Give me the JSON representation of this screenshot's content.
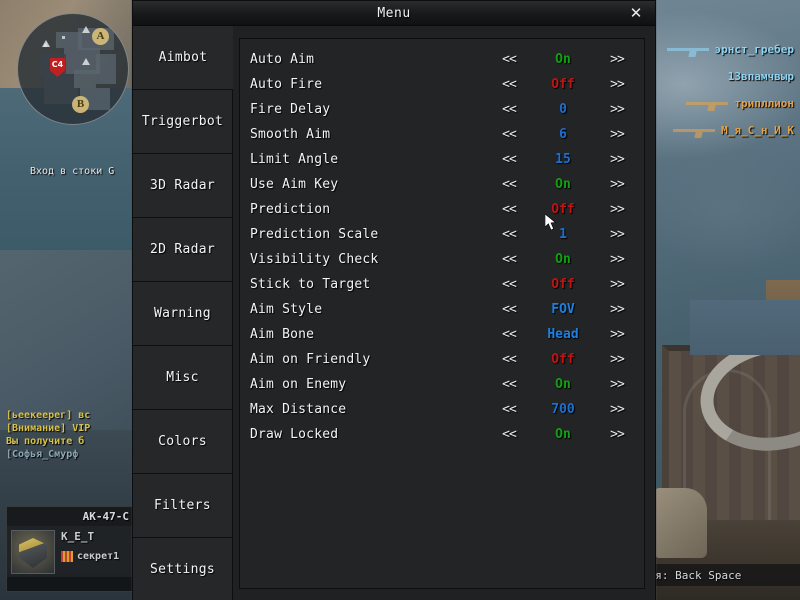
{
  "window": {
    "title": "Menu",
    "close_label": "✕",
    "close_icon": "close-icon"
  },
  "sidebar": {
    "active": "Aimbot",
    "items": [
      {
        "label": "Aimbot",
        "active": true
      },
      {
        "label": "Triggerbot",
        "active": false
      },
      {
        "label": "3D Radar",
        "active": false
      },
      {
        "label": "2D Radar",
        "active": false
      },
      {
        "label": "Warning",
        "active": false
      },
      {
        "label": "Misc",
        "active": false
      },
      {
        "label": "Colors",
        "active": false
      },
      {
        "label": "Filters",
        "active": false
      },
      {
        "label": "Settings",
        "active": false
      }
    ]
  },
  "controls": {
    "prev_label": "<<",
    "next_label": ">>"
  },
  "options": [
    {
      "label": "Auto Aim",
      "value": "On",
      "kind": "on"
    },
    {
      "label": "Auto Fire",
      "value": "Off",
      "kind": "off"
    },
    {
      "label": "Fire Delay",
      "value": "0",
      "kind": "num"
    },
    {
      "label": "Smooth Aim",
      "value": "6",
      "kind": "num"
    },
    {
      "label": "Limit Angle",
      "value": "15",
      "kind": "num"
    },
    {
      "label": "Use Aim Key",
      "value": "On",
      "kind": "on"
    },
    {
      "label": "Prediction",
      "value": "Off",
      "kind": "off"
    },
    {
      "label": "Prediction Scale",
      "value": "1",
      "kind": "num"
    },
    {
      "label": "Visibility Check",
      "value": "On",
      "kind": "on"
    },
    {
      "label": "Stick to Target",
      "value": "Off",
      "kind": "off"
    },
    {
      "label": "Aim Style",
      "value": "FOV",
      "kind": "txt"
    },
    {
      "label": "Aim Bone",
      "value": "Head",
      "kind": "txt"
    },
    {
      "label": "Aim on Friendly",
      "value": "Off",
      "kind": "off"
    },
    {
      "label": "Aim on Enemy",
      "value": "On",
      "kind": "on"
    },
    {
      "label": "Max Distance",
      "value": "700",
      "kind": "num"
    },
    {
      "label": "Draw Locked",
      "value": "On",
      "kind": "on"
    }
  ],
  "colors": {
    "on": "#12a012",
    "off": "#c01414",
    "num": "#1f6fd0",
    "txt": "#1f7fe0",
    "panel": "#222426",
    "tab": "#252729"
  },
  "game": {
    "radar": {
      "site_a": "A",
      "site_b": "B",
      "bomb_label": "C4",
      "objective_text": "Вход в стоки G"
    },
    "killfeed": [
      {
        "name": "эрнст_гребер",
        "team": "ct",
        "weapon_icon": "rifle-icon"
      },
      {
        "name": "13впамчвыр",
        "team": "ct",
        "weapon_icon": "rifle-icon"
      },
      {
        "name": "трипллион",
        "team": "t",
        "weapon_icon": "ak47-icon"
      },
      {
        "name": "М_я_С_н_И_К",
        "team": "t",
        "weapon_icon": "m4-icon"
      }
    ],
    "chat": [
      {
        "text": "[ьеекеерег] вс",
        "style": "y"
      },
      {
        "text": "[Внимание] VIP",
        "style": "y"
      },
      {
        "text": "Вы получите б",
        "style": "y"
      },
      {
        "text": "[Софья_Смурф",
        "style": "g"
      }
    ],
    "player_panel": {
      "weapon": "AK-47-C",
      "name": "K_E_T",
      "rank": "секрет1",
      "rank_icon": "rank-badge-icon",
      "avatar_icon": "clan-shield-icon"
    },
    "hint": "боя: Back Space"
  }
}
